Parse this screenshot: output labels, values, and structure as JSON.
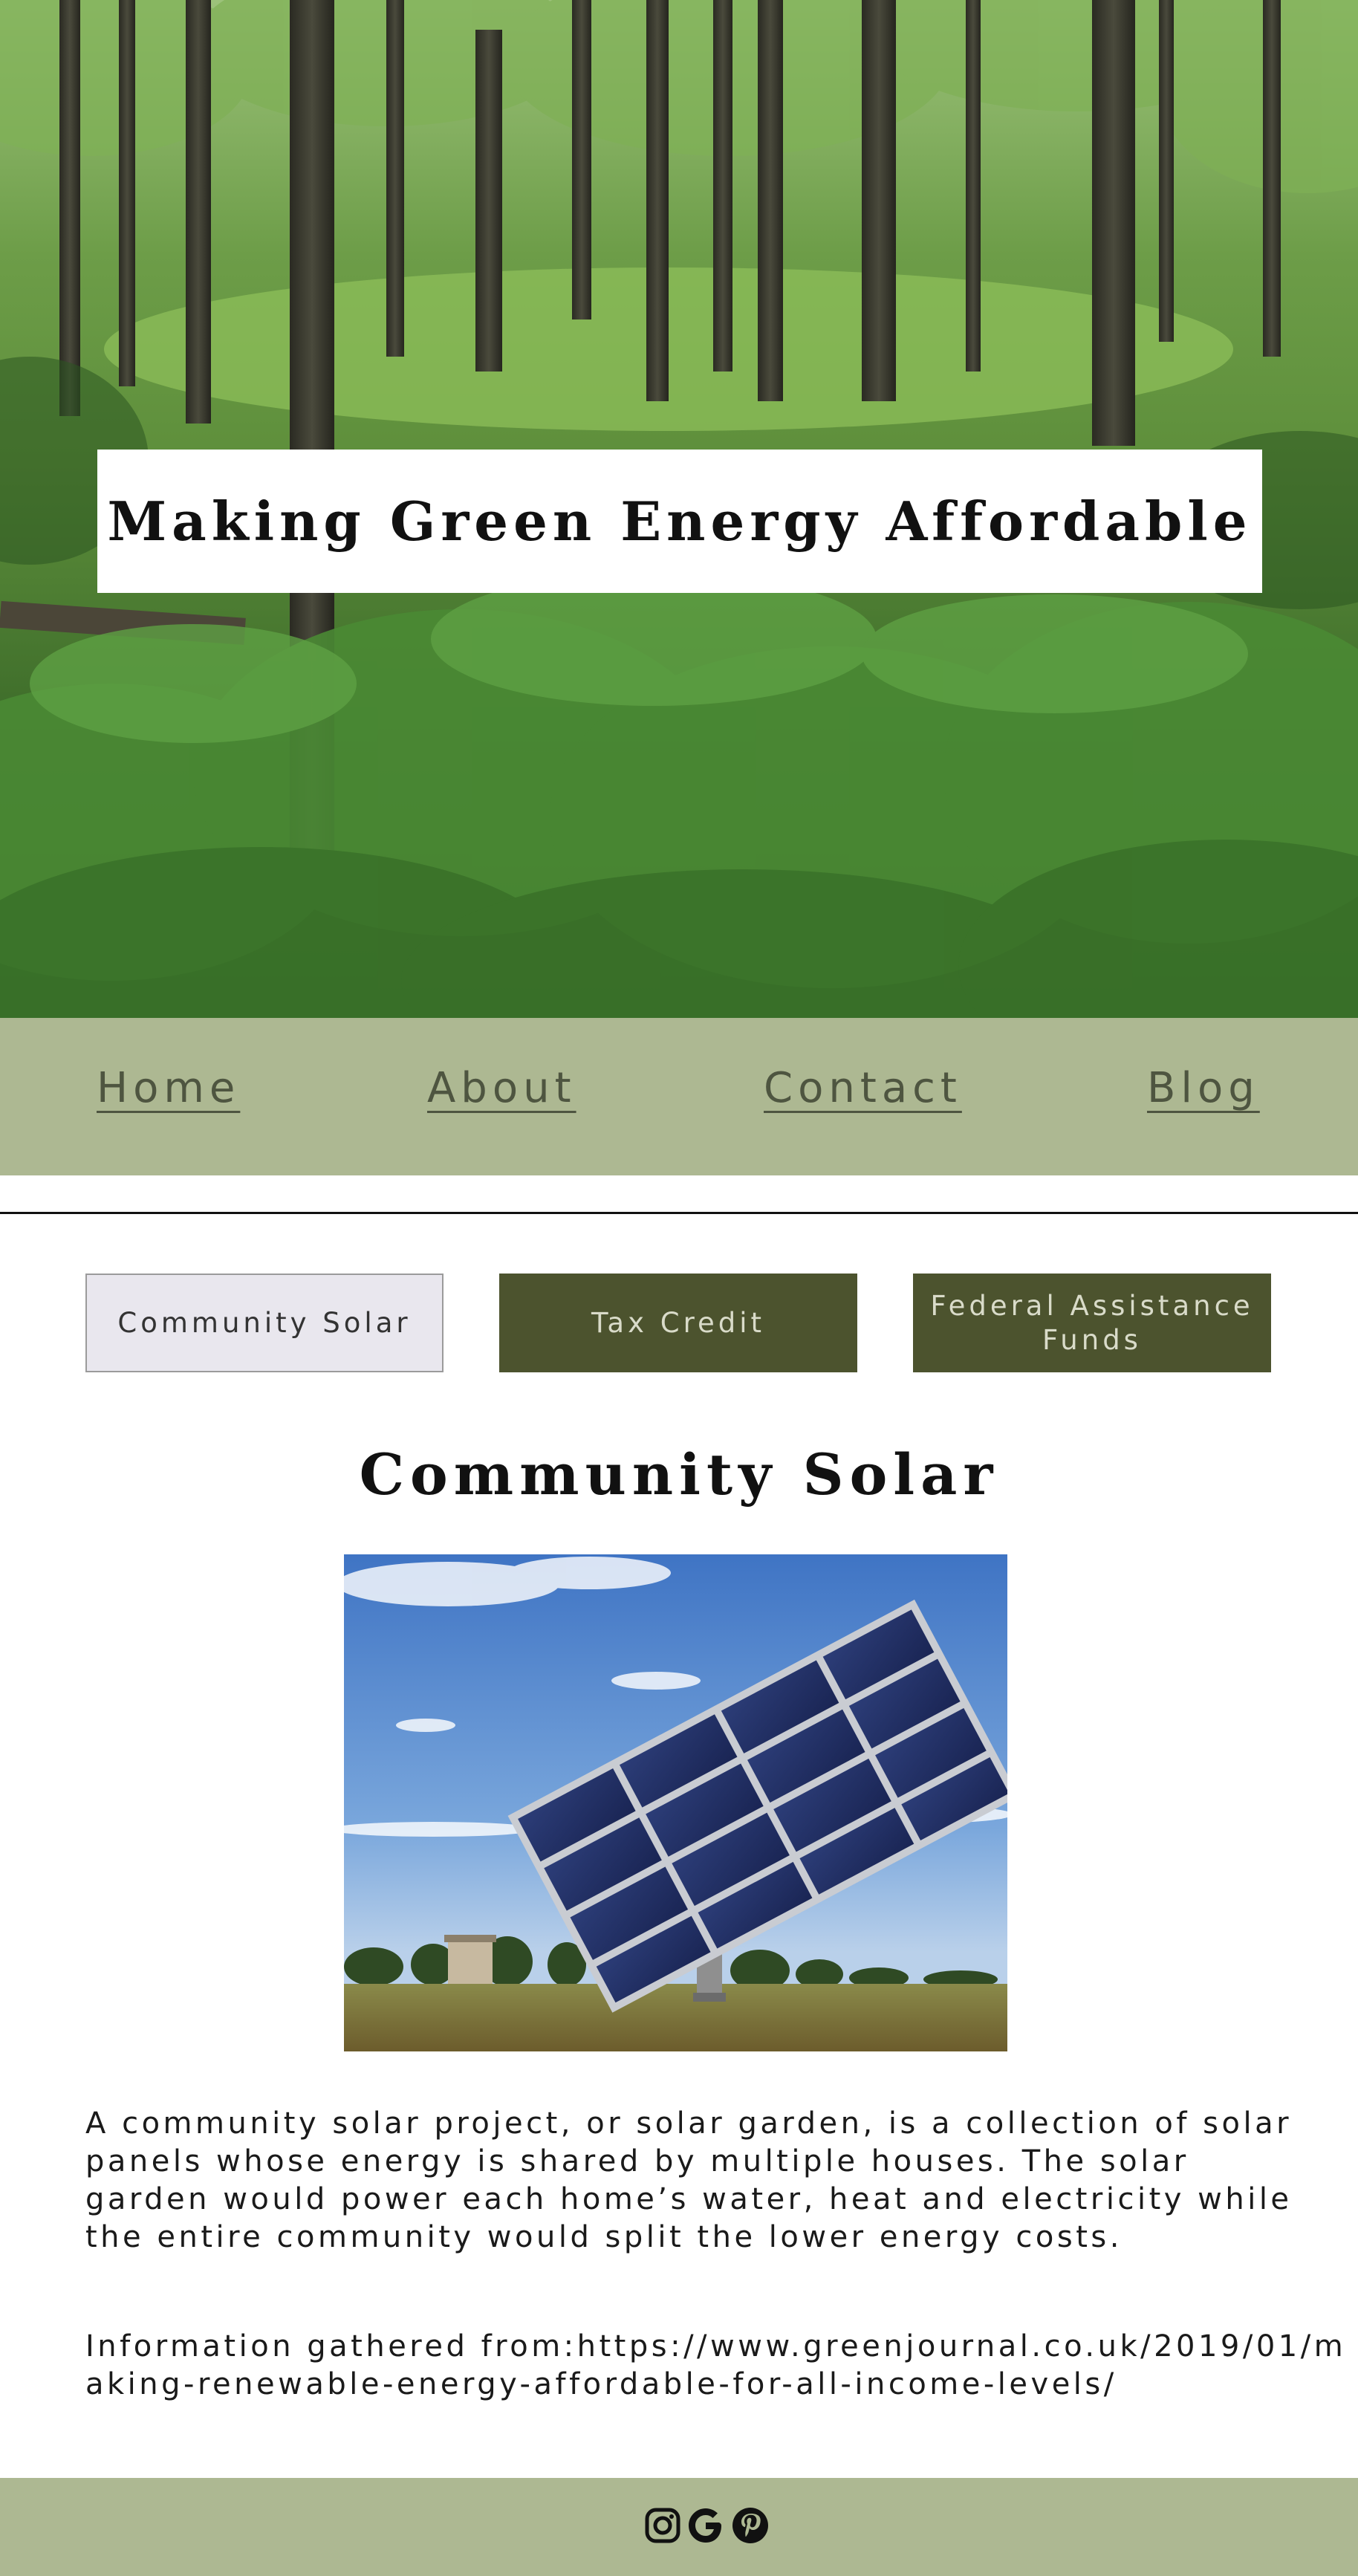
{
  "hero": {
    "title": "Making Green Energy Affordable"
  },
  "nav": {
    "items": [
      {
        "label": "Home"
      },
      {
        "label": "About"
      },
      {
        "label": "Contact"
      },
      {
        "label": "Blog"
      }
    ]
  },
  "tabs": [
    {
      "label": "Community Solar",
      "active": true
    },
    {
      "label": "Tax Credit",
      "active": false
    },
    {
      "label": "Federal Assistance Funds",
      "active": false
    }
  ],
  "content": {
    "title": "Community Solar",
    "body": "A community solar project, or solar garden, is a collection of solar panels whose energy is shared by multiple houses. The solar garden would power each home’s water, heat and electricity while the entire community would split the lower energy costs.",
    "source": "Information gathered from:https://www.greenjournal.co.uk/2019/01/making-renewable-energy-affordable-for-all-income-levels/"
  },
  "footer": {
    "icons": [
      "instagram-icon",
      "google-icon",
      "pinterest-icon"
    ]
  },
  "colors": {
    "nav_bg": "#adb892",
    "tab_inactive_bg": "#4c532e",
    "tab_active_bg": "#e9e7ee",
    "nav_text": "#4e5540"
  }
}
